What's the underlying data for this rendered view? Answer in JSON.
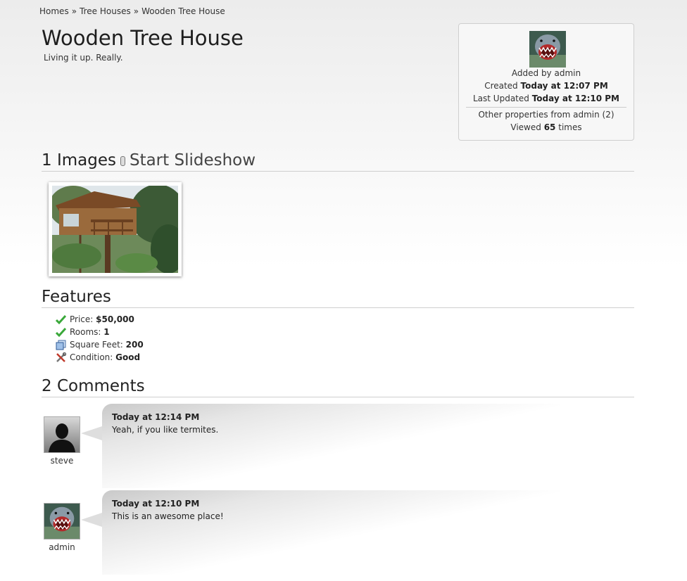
{
  "breadcrumb": {
    "items": [
      "Homes",
      "Tree Houses",
      "Wooden Tree House"
    ],
    "separator": "»"
  },
  "listing": {
    "title": "Wooden Tree House",
    "tagline": "Living it up. Really."
  },
  "info": {
    "added_by_prefix": "Added by",
    "added_by_user": "admin",
    "created_prefix": "Created",
    "created_value": "Today at 12:07 PM",
    "updated_prefix": "Last Updated",
    "updated_value": "Today at 12:10 PM",
    "other_link": "Other properties from admin (2)",
    "viewed_prefix": "Viewed",
    "viewed_count": "65",
    "viewed_suffix": "times"
  },
  "images": {
    "heading": "1 Images",
    "slideshow_label": "Start Slideshow"
  },
  "features": {
    "heading": "Features",
    "items": [
      {
        "label": "Price:",
        "value": "$50,000",
        "icon": "check-icon"
      },
      {
        "label": "Rooms:",
        "value": "1",
        "icon": "check-icon"
      },
      {
        "label": "Square Feet:",
        "value": "200",
        "icon": "square-icon"
      },
      {
        "label": "Condition:",
        "value": "Good",
        "icon": "tools-icon"
      }
    ]
  },
  "comments": {
    "heading": "2 Comments",
    "items": [
      {
        "user": "steve",
        "time": "Today at 12:14 PM",
        "text": "Yeah, if you like termites."
      },
      {
        "user": "admin",
        "time": "Today at 12:10 PM",
        "text": "This is an awesome place!"
      }
    ]
  },
  "colors": {
    "check": "#3aa83a",
    "accent_text": "#222222"
  }
}
